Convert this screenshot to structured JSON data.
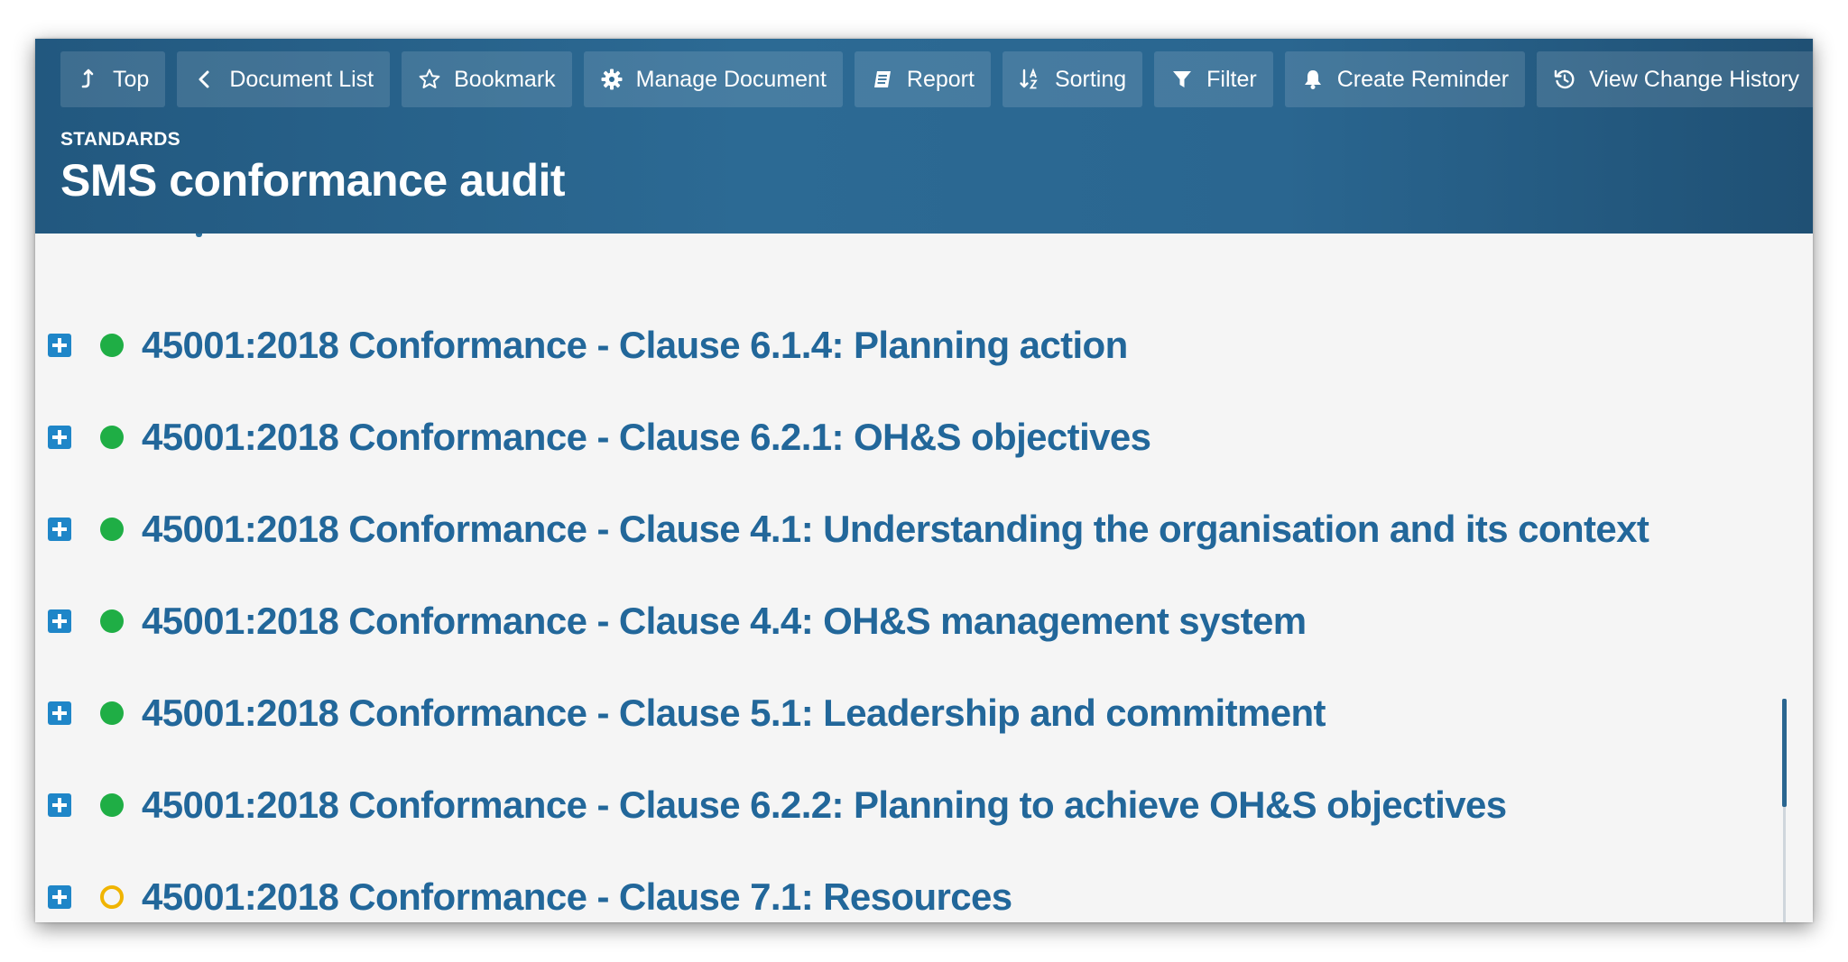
{
  "toolbar": {
    "buttons": [
      {
        "label": "Top",
        "icon": "arrow-up-icon"
      },
      {
        "label": "Document List",
        "icon": "chevron-left-icon"
      },
      {
        "label": "Bookmark",
        "icon": "star-icon"
      },
      {
        "label": "Manage Document",
        "icon": "gear-icon"
      },
      {
        "label": "Report",
        "icon": "report-icon"
      },
      {
        "label": "Sorting",
        "icon": "sort-az-icon"
      },
      {
        "label": "Filter",
        "icon": "filter-icon"
      },
      {
        "label": "Create Reminder",
        "icon": "bell-icon"
      },
      {
        "label": "View Change History",
        "icon": "history-icon"
      }
    ]
  },
  "header": {
    "breadcrumb": "STANDARDS",
    "title": "SMS conformance audit"
  },
  "items": [
    {
      "label": "45001:2018 Conformance - Clause 6.1.4: Planning action",
      "status": "complete"
    },
    {
      "label": "45001:2018 Conformance - Clause 6.2.1: OH&S objectives",
      "status": "complete"
    },
    {
      "label": "45001:2018 Conformance - Clause 4.1: Understanding the organisation and its context",
      "status": "complete"
    },
    {
      "label": "45001:2018 Conformance - Clause 4.4: OH&S management system",
      "status": "complete"
    },
    {
      "label": "45001:2018 Conformance - Clause 5.1: Leadership and commitment",
      "status": "complete"
    },
    {
      "label": "45001:2018 Conformance - Clause 6.2.2: Planning to achieve OH&S objectives",
      "status": "complete"
    },
    {
      "label": "45001:2018 Conformance - Clause 7.1: Resources",
      "status": "open"
    }
  ],
  "colors": {
    "header_bg": "#2a6690",
    "link_text": "#22679a",
    "expand_button": "#1f86c8",
    "status_complete": "#1fae45",
    "status_open": "#f0b400"
  }
}
